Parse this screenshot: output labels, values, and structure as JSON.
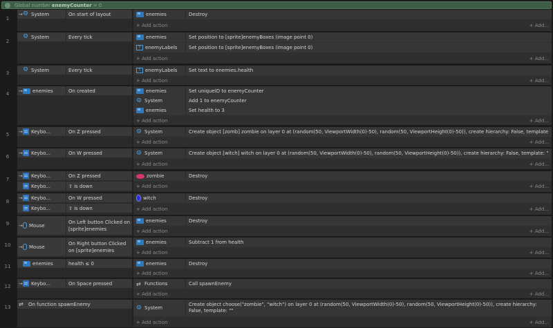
{
  "global": {
    "prefix": "Global number",
    "name": "enemyCounter",
    "suffix": "= 0"
  },
  "ui": {
    "add_action": "Add action",
    "add_more": "Add..."
  },
  "events": [
    {
      "num": "1",
      "conds": [
        {
          "arrow": "→",
          "icon": "gear",
          "obj": "System",
          "text": "On start of layout"
        }
      ],
      "acts": [
        {
          "icon": "sprite",
          "obj": "enemies",
          "text": "Destroy"
        }
      ]
    },
    {
      "num": "2",
      "conds": [
        {
          "arrow": "",
          "icon": "gear",
          "obj": "System",
          "text": "Every tick"
        }
      ],
      "acts": [
        {
          "icon": "sprite",
          "obj": "enemies",
          "text": "Set position to [sprite]enemyBoxes (image point 0)"
        },
        {
          "icon": "text",
          "obj": "enemyLabels",
          "text": "Set position to [sprite]enemyBoxes (image point 0)"
        }
      ]
    },
    {
      "num": "3",
      "conds": [
        {
          "arrow": "",
          "icon": "gear",
          "obj": "System",
          "text": "Every tick"
        }
      ],
      "acts": [
        {
          "icon": "text",
          "obj": "enemyLabels",
          "text": "Set text to enemies.health"
        }
      ]
    },
    {
      "num": "4",
      "conds": [
        {
          "arrow": "→",
          "icon": "sprite",
          "obj": "enemies",
          "text": "On created"
        }
      ],
      "acts": [
        {
          "icon": "sprite",
          "obj": "enemies",
          "text": "Set uniqueID to enemyCounter"
        },
        {
          "icon": "gear",
          "obj": "System",
          "text": "Add 1 to enemyCounter"
        },
        {
          "icon": "sprite",
          "obj": "enemies",
          "text": "Set health to 3"
        }
      ]
    },
    {
      "num": "5",
      "conds": [
        {
          "arrow": "→",
          "icon": "kb",
          "obj": "Keybo...",
          "text": "On Z pressed"
        }
      ],
      "acts": [
        {
          "icon": "gear",
          "obj": "System",
          "text": "Create object [zomb] zombie on layer 0 at (random(50, ViewportWidth(0)-50), random(50, ViewportHeight(0)-50)), create hierarchy: False, template: \"\""
        }
      ]
    },
    {
      "num": "6",
      "conds": [
        {
          "arrow": "→",
          "icon": "kb",
          "obj": "Keybo...",
          "text": "On W pressed"
        }
      ],
      "acts": [
        {
          "icon": "gear",
          "obj": "System",
          "text": "Create object [witch] witch on layer 0 at (random(50, ViewportWidth(0)-50), random(50, ViewportHeight(0)-50)), create hierarchy: False, template: \"\""
        }
      ]
    },
    {
      "num": "7",
      "conds": [
        {
          "arrow": "→",
          "icon": "kb",
          "obj": "Keybo...",
          "text": "On Z pressed"
        },
        {
          "arrow": "",
          "icon": "kb",
          "obj": "Keybo...",
          "text": "⇧ is down"
        }
      ],
      "acts": [
        {
          "icon": "zomb",
          "obj": "zombie",
          "text": "Destroy"
        }
      ]
    },
    {
      "num": "8",
      "conds": [
        {
          "arrow": "→",
          "icon": "kb",
          "obj": "Keybo...",
          "text": "On W pressed"
        },
        {
          "arrow": "",
          "icon": "kb",
          "obj": "Keybo...",
          "text": "⇧ is down"
        }
      ],
      "acts": [
        {
          "icon": "witch",
          "obj": "witch",
          "text": "Destroy"
        }
      ]
    },
    {
      "num": "9",
      "conds": [
        {
          "arrow": "→",
          "icon": "mouse",
          "obj": "Mouse",
          "text": "On Left button Clicked on [sprite]enemies"
        }
      ],
      "acts": [
        {
          "icon": "sprite",
          "obj": "enemies",
          "text": "Destroy"
        }
      ]
    },
    {
      "num": "10",
      "conds": [
        {
          "arrow": "→",
          "icon": "mouse",
          "obj": "Mouse",
          "text": "On Right button Clicked on [sprite]enemies"
        }
      ],
      "acts": [
        {
          "icon": "sprite",
          "obj": "enemies",
          "text": "Subtract 1 from health"
        }
      ]
    },
    {
      "num": "11",
      "conds": [
        {
          "arrow": "",
          "icon": "sprite",
          "obj": "enemies",
          "text": "health ≤ 0"
        }
      ],
      "acts": [
        {
          "icon": "sprite",
          "obj": "enemies",
          "text": "Destroy"
        }
      ]
    },
    {
      "num": "12",
      "conds": [
        {
          "arrow": "→",
          "icon": "kb",
          "obj": "Keybo...",
          "text": "On Space pressed"
        }
      ],
      "acts": [
        {
          "icon": "func",
          "obj": "Functions",
          "text": "Call spawnEnemy"
        }
      ]
    },
    {
      "num": "13",
      "conds": [
        {
          "arrow": "",
          "icon": "func",
          "obj": "",
          "text": "On function spawnEnemy"
        }
      ],
      "acts": [
        {
          "icon": "gear",
          "obj": "System",
          "text": "Create object choose(\"zombie\", \"witch\") on layer 0 at (random(50, ViewportWidth(0)-50), random(50, ViewportHeight(0)-50)), create hierarchy: False, template: \"\""
        }
      ]
    }
  ]
}
